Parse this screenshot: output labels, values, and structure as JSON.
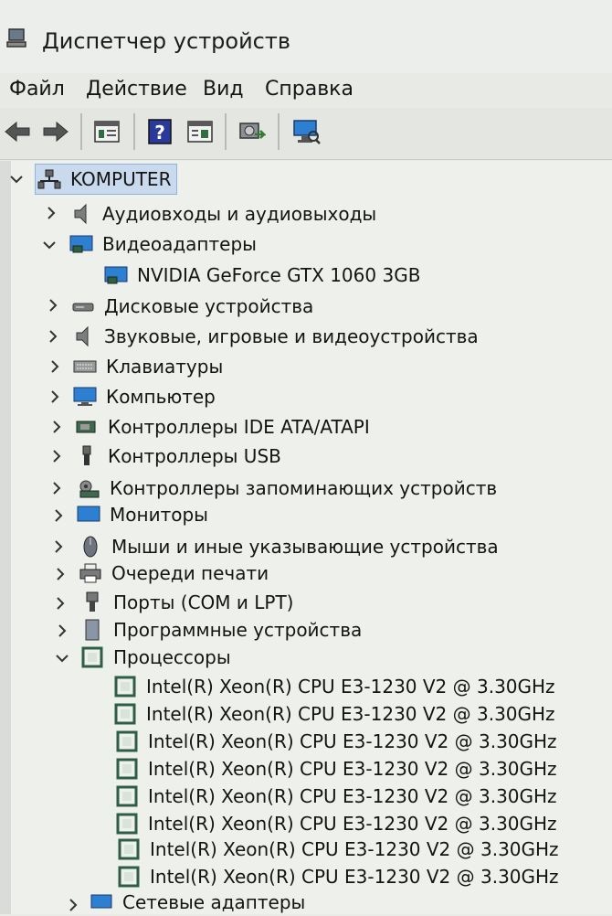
{
  "window": {
    "title": "Диспетчер устройств"
  },
  "menu": {
    "file": "Файл",
    "action": "Действие",
    "view": "Вид",
    "help": "Справка"
  },
  "toolbar": {
    "buttons": [
      "back-arrow-icon",
      "forward-arrow-icon",
      "properties-pane-icon",
      "help-icon",
      "show-hidden-icon",
      "update-driver-icon",
      "scan-hardware-icon"
    ]
  },
  "tree": {
    "root": "KOMPUTER",
    "categories": {
      "audio_io": "Аудиовходы и аудиовыходы",
      "video": "Видеоадаптеры",
      "video_child": "NVIDIA GeForce GTX 1060 3GB",
      "disk": "Дисковые устройства",
      "sound": "Звуковые, игровые и видеоустройства",
      "keyboards": "Клавиатуры",
      "computer": "Компьютер",
      "ide": "Контроллеры IDE ATA/ATAPI",
      "usb": "Контроллеры USB",
      "storage": "Контроллеры запоминающих устройств",
      "monitors": "Мониторы",
      "mice": "Мыши и иные указывающие устройства",
      "print": "Очереди печати",
      "ports": "Порты (COM и LPT)",
      "software": "Программные устройства",
      "cpu": "Процессоры",
      "network": "Сетевые адаптеры"
    },
    "processors": [
      "Intel(R) Xeon(R) CPU E3-1230 V2 @ 3.30GHz",
      "Intel(R) Xeon(R) CPU E3-1230 V2 @ 3.30GHz",
      "Intel(R) Xeon(R) CPU E3-1230 V2 @ 3.30GHz",
      "Intel(R) Xeon(R) CPU E3-1230 V2 @ 3.30GHz",
      "Intel(R) Xeon(R) CPU E3-1230 V2 @ 3.30GHz",
      "Intel(R) Xeon(R) CPU E3-1230 V2 @ 3.30GHz",
      "Intel(R) Xeon(R) CPU E3-1230 V2 @ 3.30GHz",
      "Intel(R) Xeon(R) CPU E3-1230 V2 @ 3.30GHz"
    ]
  },
  "colors": {
    "selection": "#c9d9ee",
    "monitor_blue": "#2d7fd1",
    "chip_green": "#2f5e46"
  }
}
